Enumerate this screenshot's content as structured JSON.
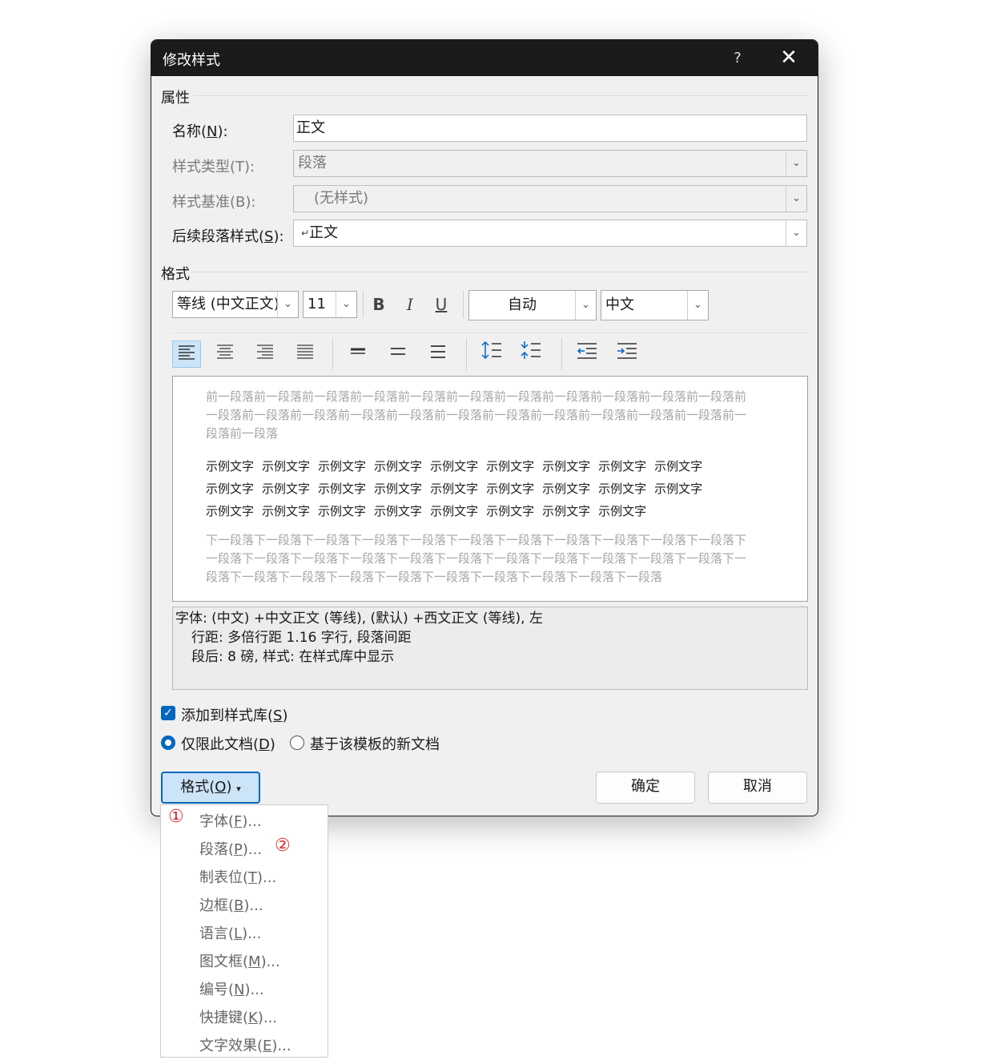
{
  "dialog": {
    "title": "修改样式",
    "help": "?",
    "close": "✕"
  },
  "properties": {
    "section": "属性",
    "name_label_pre": "名称(",
    "name_label_key": "N",
    "name_label_post": "):",
    "name_value": "正文",
    "style_type_label": "样式类型(T):",
    "style_type_value": "段落",
    "style_based_label": "样式基准(B):",
    "style_based_value": "(无样式)",
    "next_style_label_pre": "后续段落样式(",
    "next_style_label_key": "S",
    "next_style_label_post": "):",
    "next_style_mark": "↵",
    "next_style_value": "正文"
  },
  "format": {
    "section": "格式",
    "font": "等线 (中文正文)",
    "size": "11",
    "bold": "B",
    "italic": "I",
    "underline": "U",
    "color": "自动",
    "language": "中文"
  },
  "preview": {
    "prev_text": "前一段落前一段落前一段落前一段落前一段落前一段落前一段落前一段落前一段落前一段落前一段落前一段落前一段落前一段落前一段落前一段落前一段落前一段落前一段落前一段落前一段落前一段落前一段落前一段落",
    "sample_word": "示例文字",
    "next_text": "下一段落下一段落下一段落下一段落下一段落下一段落下一段落下一段落下一段落下一段落下一段落下一段落下一段落下一段落下一段落下一段落下一段落下一段落下一段落下一段落下一段落下一段落下一段落下一段落下一段落下一段落下一段落下一段落下一段落下一段落下一段落下一段落"
  },
  "description": {
    "line1": "字体: (中文) +中文正文 (等线), (默认) +西文正文 (等线), 左",
    "line2": "行距: 多倍行距 1.16 字行, 段落间距",
    "line3": "段后: 8 磅, 样式: 在样式库中显示"
  },
  "options": {
    "add_to_gallery_pre": "添加到样式库(",
    "add_to_gallery_key": "S",
    "add_to_gallery_post": ")",
    "only_this_doc_pre": "仅限此文档(",
    "only_this_doc_key": "D",
    "only_this_doc_post": ")",
    "new_docs": "基于该模板的新文档"
  },
  "buttons": {
    "format_pre": "格式(",
    "format_key": "O",
    "format_post": ")",
    "format_caret": "▾",
    "ok": "确定",
    "cancel": "取消"
  },
  "menu": {
    "items": [
      {
        "pre": "字体(",
        "key": "F",
        "post": ")..."
      },
      {
        "pre": "段落(",
        "key": "P",
        "post": ")..."
      },
      {
        "pre": "制表位(",
        "key": "T",
        "post": ")..."
      },
      {
        "pre": "边框(",
        "key": "B",
        "post": ")..."
      },
      {
        "pre": "语言(",
        "key": "L",
        "post": ")..."
      },
      {
        "pre": "图文框(",
        "key": "M",
        "post": ")..."
      },
      {
        "pre": "编号(",
        "key": "N",
        "post": ")..."
      },
      {
        "pre": "快捷键(",
        "key": "K",
        "post": ")..."
      },
      {
        "pre": "文字效果(",
        "key": "E",
        "post": ")..."
      }
    ],
    "marker1": "①",
    "marker2": "②"
  },
  "colors": {
    "accent": "#0067c0",
    "marker": "#e0282d"
  }
}
